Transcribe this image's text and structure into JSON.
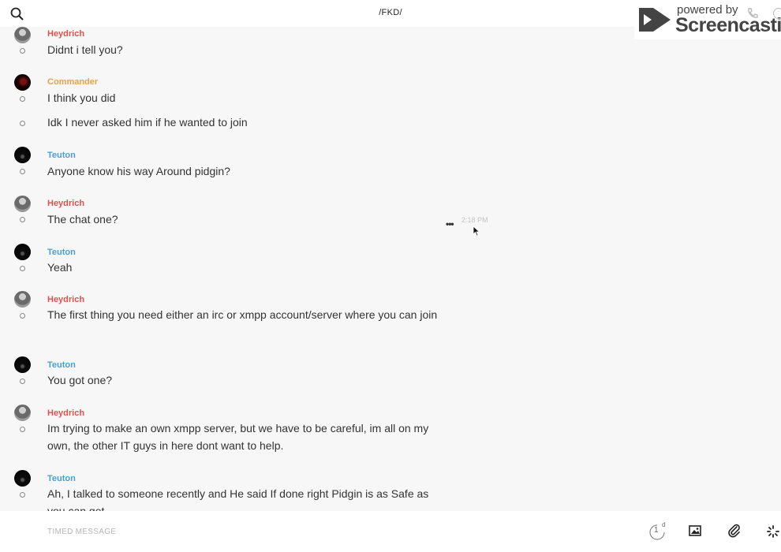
{
  "header": {
    "title": "/FKD/",
    "search_icon": "search-icon"
  },
  "watermark": {
    "small": "powered by",
    "big": "Screencastify"
  },
  "messages": [
    {
      "sender": "Heydrich",
      "text": "Didnt i tell you?"
    },
    {
      "sender": "Commander",
      "text": "I think you did"
    },
    {
      "sender": "",
      "text": "Idk I never asked him if he wanted to join"
    },
    {
      "sender": "Teuton",
      "text": "Anyone know his way Around pidgin?"
    },
    {
      "sender": "Heydrich",
      "text": "The chat one?"
    },
    {
      "sender": "Teuton",
      "text": "Yeah"
    },
    {
      "sender": "Heydrich",
      "text": "The first thing you need either an irc or xmpp account/server where you can join"
    },
    {
      "sender": "Teuton",
      "text": "You got one?"
    },
    {
      "sender": "Heydrich",
      "text": "Im trying to make an own xmpp server, but we have to be careful, im all on my own, the other IT guys in here dont want to help."
    },
    {
      "sender": "Teuton",
      "text": "Ah, I talked to someone recently and He said If done right Pidgin is as Safe as you can get"
    }
  ],
  "hover": {
    "more": "•••",
    "timestamp": "2:18 PM"
  },
  "composer": {
    "placeholder": "TIMED MESSAGE",
    "timer_value": "1",
    "timer_unit": "d"
  },
  "colors": {
    "heydrich": "#d9534f",
    "commander": "#e8a04c",
    "teuton": "#4a9fd6"
  }
}
